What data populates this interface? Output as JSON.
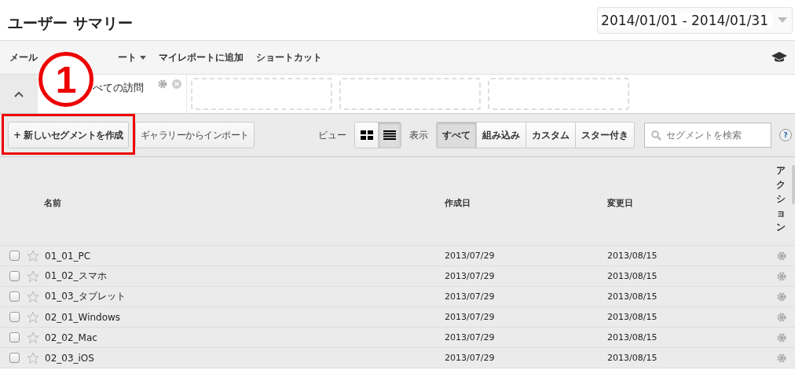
{
  "page_title": "ユーザー サマリー",
  "date_range": "2014/01/01 - 2014/01/31",
  "menu": [
    "メール",
    "ート",
    "マイレポートに追加",
    "ショートカット"
  ],
  "applied_segment": {
    "label": "べての訪問"
  },
  "annotation": {
    "number": "1"
  },
  "toolbar": {
    "create_button": "+ 新しいセグメントを作成",
    "import_button": "ギャラリーからインポート",
    "view_label": "ビュー",
    "views": [
      {
        "kind": "grid",
        "selected": false
      },
      {
        "kind": "list",
        "selected": true
      }
    ],
    "filter_label": "表示",
    "filters": [
      {
        "label": "すべて",
        "selected": true
      },
      {
        "label": "組み込み",
        "selected": false
      },
      {
        "label": "カスタム",
        "selected": false
      },
      {
        "label": "スター付き",
        "selected": false
      }
    ],
    "search": {
      "placeholder": "セグメントを検索"
    },
    "help": "?"
  },
  "table": {
    "columns": [
      "名前",
      "作成日",
      "変更日",
      "アクション"
    ],
    "rows": [
      {
        "name": "01_01_PC",
        "created": "2013/07/29",
        "modified": "2013/08/15",
        "checked": false,
        "starred": false
      },
      {
        "name": "01_02_スマホ",
        "created": "2013/07/29",
        "modified": "2013/08/15",
        "checked": false,
        "starred": false
      },
      {
        "name": "01_03_タブレット",
        "created": "2013/07/29",
        "modified": "2013/08/15",
        "checked": false,
        "starred": false
      },
      {
        "name": "02_01_Windows",
        "created": "2013/07/29",
        "modified": "2013/08/15",
        "checked": false,
        "starred": false
      },
      {
        "name": "02_02_Mac",
        "created": "2013/07/29",
        "modified": "2013/08/15",
        "checked": false,
        "starred": false
      },
      {
        "name": "02_03_iOS",
        "created": "2013/07/29",
        "modified": "2013/08/15",
        "checked": false,
        "starred": false
      }
    ]
  }
}
